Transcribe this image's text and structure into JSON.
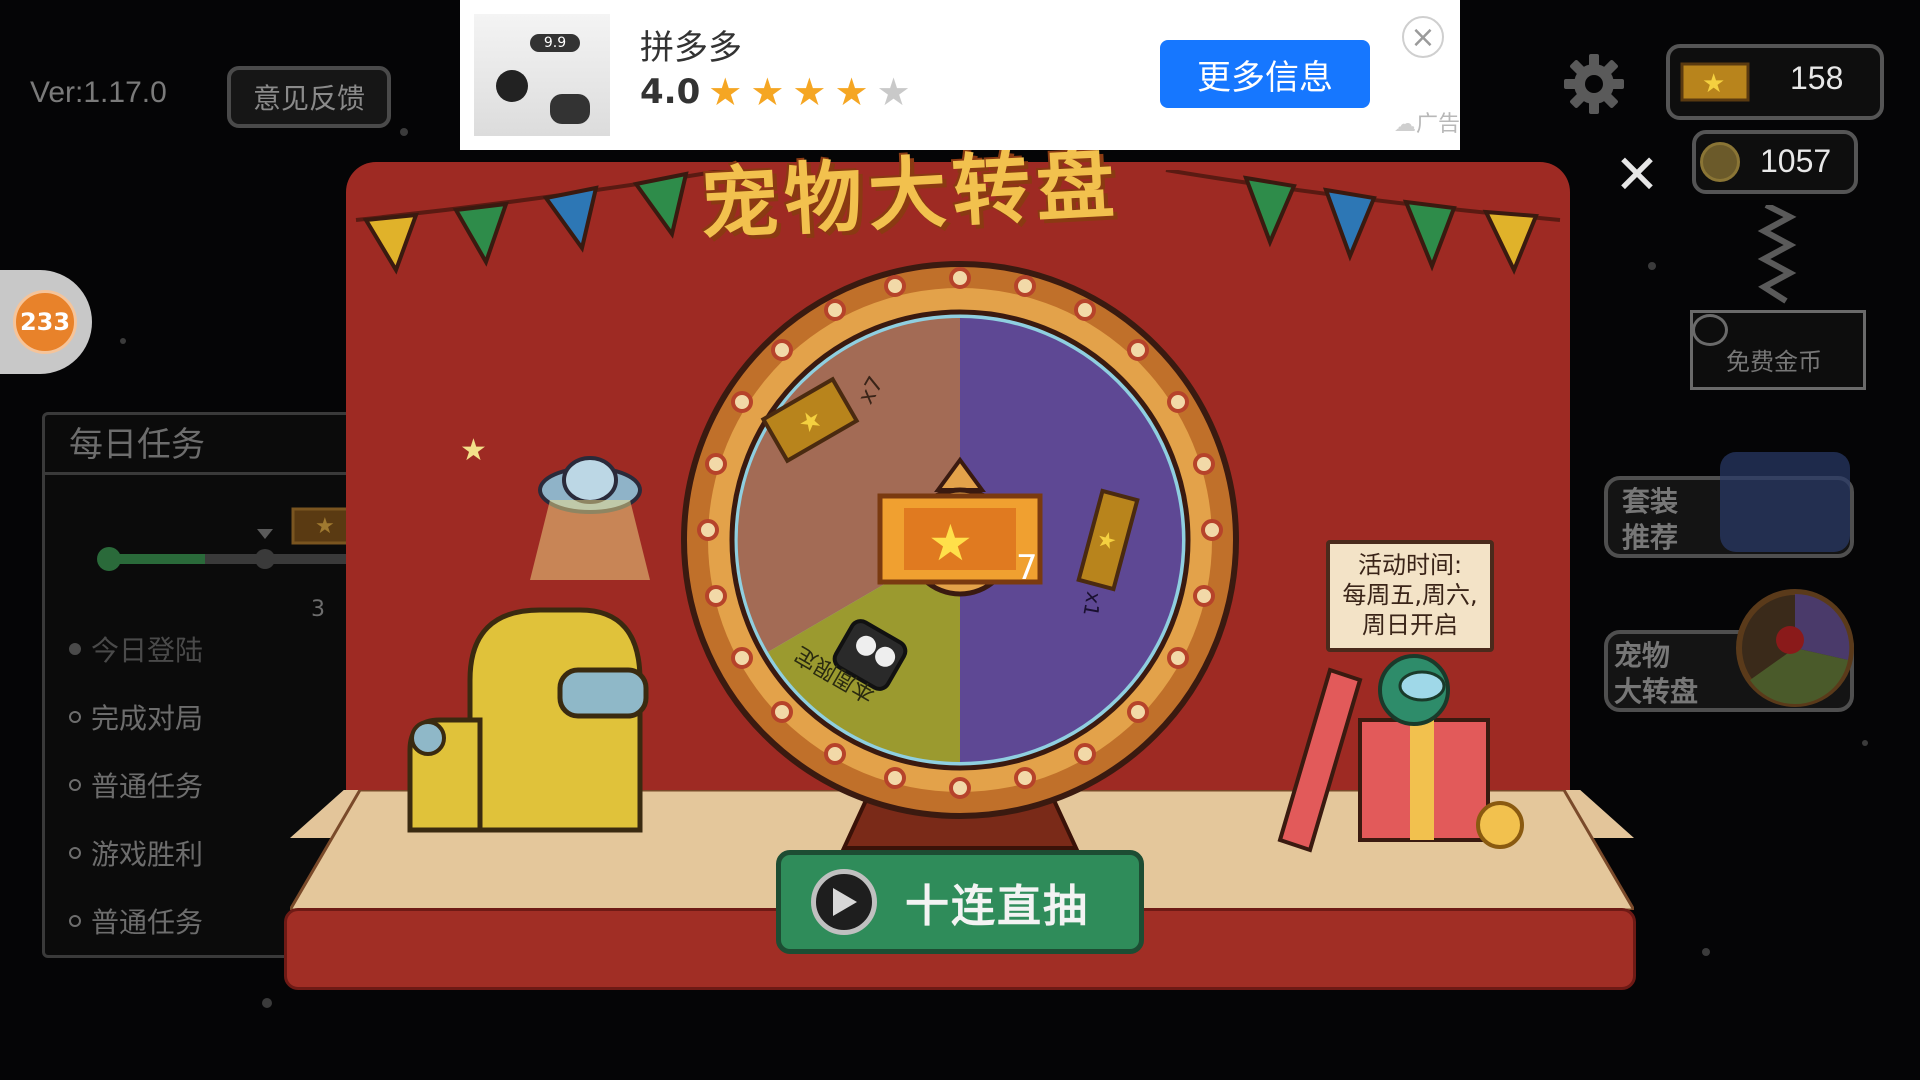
{
  "version": "Ver:1.17.0",
  "feedback_label": "意见反馈",
  "bubble_badge": "233",
  "daily_tasks": {
    "title": "每日任务",
    "progress_marker": "3",
    "items": [
      {
        "label": "今日登陆",
        "done": true
      },
      {
        "label": "完成对局",
        "done": false
      },
      {
        "label": "普通任务",
        "done": false
      },
      {
        "label": "游戏胜利",
        "done": false
      },
      {
        "label": "普通任务",
        "done": false
      }
    ]
  },
  "ad": {
    "app_name": "拼多多",
    "rating": "4.0",
    "stars_filled": 4,
    "stars_total": 5,
    "cta": "更多信息",
    "label": "广告",
    "thumb_price": "9.9"
  },
  "currency": {
    "tickets": "158",
    "coins": "1057"
  },
  "free_coins_label": "免费金币",
  "side_buttons": {
    "outfit": "套装\n推荐",
    "wheel": "宠物\n大转盘"
  },
  "wheel": {
    "title": "宠物大转盘",
    "segments": [
      {
        "label": "x7",
        "color": "#a36b55"
      },
      {
        "label": "x1",
        "color": "#5e4894"
      },
      {
        "label": "本周限定",
        "color": "#9b9a2f"
      }
    ],
    "center_count": "7"
  },
  "event_sign": {
    "line1": "活动时间:",
    "line2": "每周五,周六,",
    "line3": "周日开启"
  },
  "draw_button": "十连直抽",
  "colors": {
    "stage_red": "#9e2a23",
    "button_green": "#2f8c5a",
    "ad_blue": "#1677ff",
    "gold": "#f2c14e"
  }
}
